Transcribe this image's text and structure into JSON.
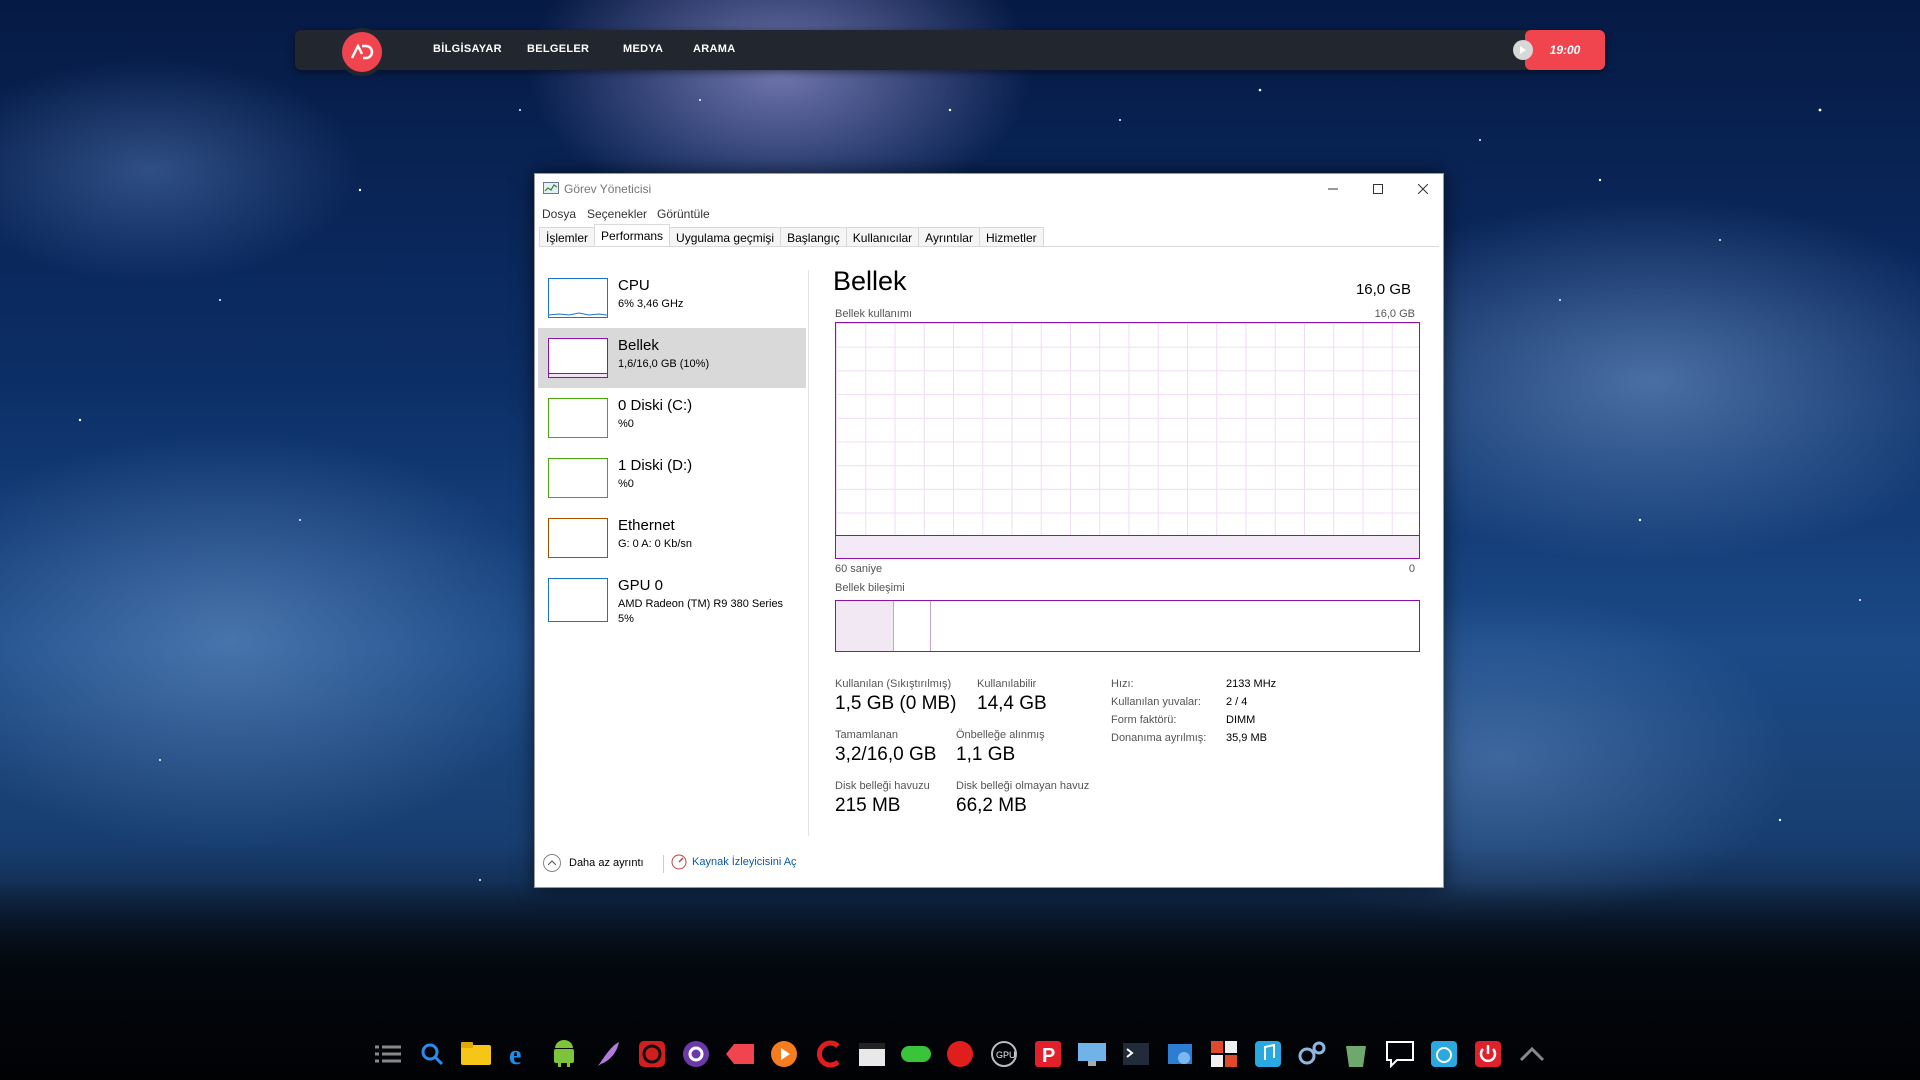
{
  "topbar": {
    "nav": [
      "BİLGİSAYAR",
      "BELGELER",
      "MEDYA",
      "ARAMA"
    ],
    "clock": "19:00"
  },
  "window": {
    "title": "Görev Yöneticisi",
    "menu": [
      "Dosya",
      "Seçenekler",
      "Görüntüle"
    ],
    "tabs": [
      "İşlemler",
      "Performans",
      "Uygulama geçmişi",
      "Başlangıç",
      "Kullanıcılar",
      "Ayrıntılar",
      "Hizmetler"
    ],
    "active_tab": "Performans"
  },
  "resources": [
    {
      "name": "CPU",
      "sub": "6% 3,46 GHz",
      "color": "#1a74c7"
    },
    {
      "name": "Bellek",
      "sub": "1,6/16,0 GB (10%)",
      "color": "#8b12ae"
    },
    {
      "name": "0 Diski (C:)",
      "sub": "%0",
      "color": "#4da60c"
    },
    {
      "name": "1 Diski (D:)",
      "sub": "%0",
      "color": "#4da60c"
    },
    {
      "name": "Ethernet",
      "sub": "G: 0 A: 0 Kb/sn",
      "color": "#a74f01"
    },
    {
      "name": "GPU 0",
      "sub": "AMD Radeon (TM) R9 380 Series",
      "sub2": "5%",
      "color": "#1a74c7"
    }
  ],
  "memory": {
    "title": "Bellek",
    "total": "16,0 GB",
    "usage_label": "Bellek kullanımı",
    "usage_max": "16,0 GB",
    "time_label": "60 saniye",
    "zero_label": "0",
    "composition_label": "Bellek bileşimi",
    "usage_fraction": 0.1,
    "stats": {
      "in_use": {
        "label": "Kullanılan (Sıkıştırılmış)",
        "value": "1,5 GB (0 MB)"
      },
      "available": {
        "label": "Kullanılabilir",
        "value": "14,4 GB"
      },
      "committed": {
        "label": "Tamamlanan",
        "value": "3,2/16,0 GB"
      },
      "cached": {
        "label": "Önbelleğe alınmış",
        "value": "1,1 GB"
      },
      "paged": {
        "label": "Disk belleği havuzu",
        "value": "215 MB"
      },
      "nonpaged": {
        "label": "Disk belleği olmayan havuz",
        "value": "66,2 MB"
      }
    },
    "specs": [
      {
        "key": "Hızı:",
        "value": "2133 MHz"
      },
      {
        "key": "Kullanılan yuvalar:",
        "value": "2 / 4"
      },
      {
        "key": "Form faktörü:",
        "value": "DIMM"
      },
      {
        "key": "Donanıma ayrılmış:",
        "value": "35,9 MB"
      }
    ]
  },
  "footer": {
    "fewer_details": "Daha az ayrıntı",
    "resource_monitor": "Kaynak İzleyicisini Aç"
  },
  "dock": [
    "menu-icon",
    "search-icon",
    "folder-icon",
    "internet-explorer-icon",
    "android-icon",
    "feather-icon",
    "game-icon",
    "browser-icon",
    "splash-icon",
    "play-icon",
    "app-icon",
    "clapper-icon",
    "gamepad-icon",
    "red-app-icon",
    "gpu-icon",
    "pinterest-icon",
    "monitor-icon",
    "terminal-icon",
    "settings-window-icon",
    "office-icon",
    "music-icon",
    "gears-icon",
    "recycle-bin-icon",
    "chat-icon",
    "power-settings-icon",
    "power-icon",
    "chevron-up-icon"
  ]
}
